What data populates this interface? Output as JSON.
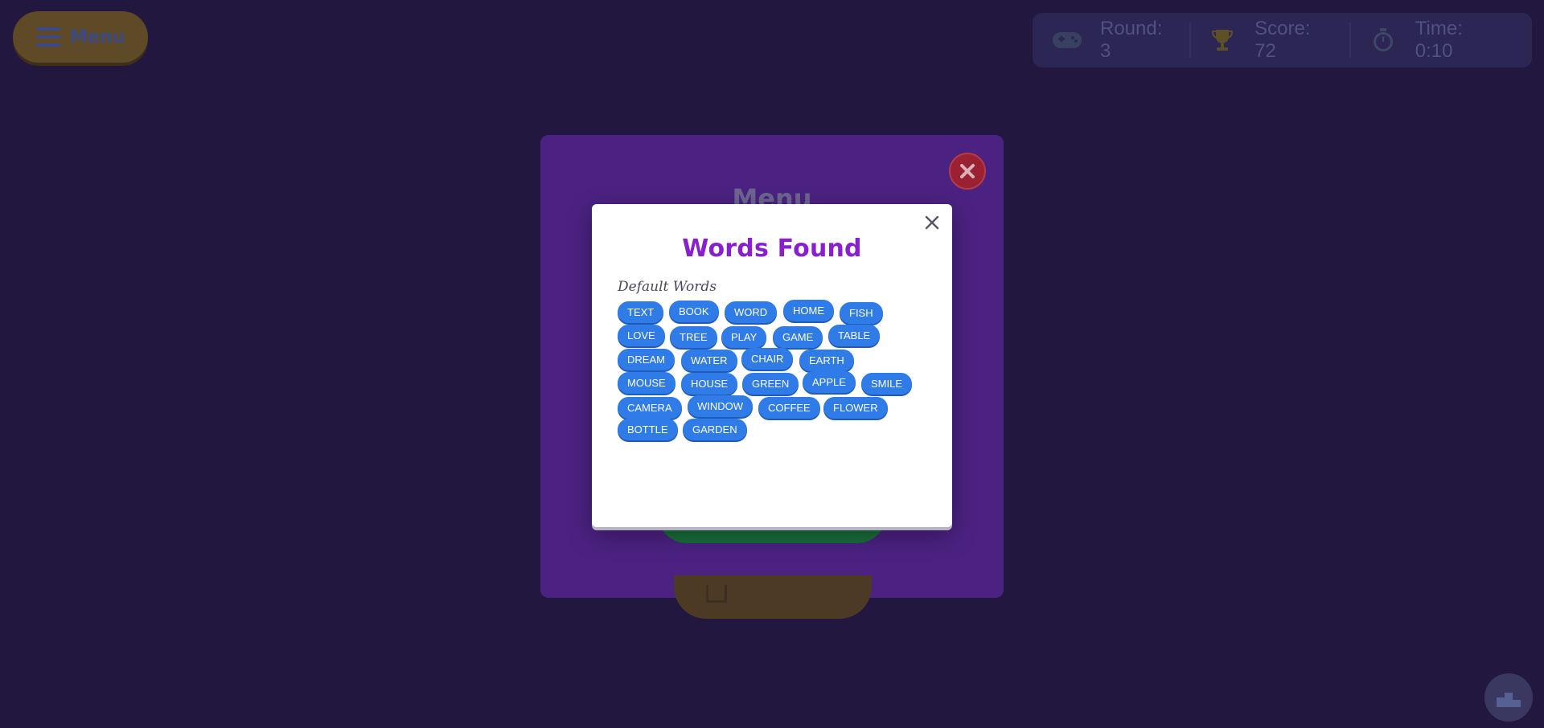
{
  "menu_button": {
    "label": "Menu"
  },
  "stats": {
    "round_label": "Round: 3",
    "score_label": "Score: 72",
    "time_label": "Time: 0:10"
  },
  "menu_panel": {
    "title": "Menu"
  },
  "modal": {
    "title": "Words Found",
    "section_title": "Default Words",
    "words": [
      "TEXT",
      "BOOK",
      "WORD",
      "HOME",
      "FISH",
      "LOVE",
      "TREE",
      "PLAY",
      "GAME",
      "TABLE",
      "DREAM",
      "WATER",
      "CHAIR",
      "EARTH",
      "MOUSE",
      "HOUSE",
      "GREEN",
      "APPLE",
      "SMILE",
      "CAMERA",
      "WINDOW",
      "COFFEE",
      "FLOWER",
      "BOTTLE",
      "GARDEN"
    ]
  },
  "colors": {
    "background": "#22183f",
    "panel": "#4b2282",
    "modal_title": "#8a1fcf",
    "chip": "#2f7be8",
    "close_button": "#9a2132"
  },
  "icons": {
    "menu": "hamburger-icon",
    "round": "gamepad-icon",
    "score": "trophy-icon",
    "time": "stopwatch-icon",
    "panel_close": "close-icon",
    "modal_close": "close-icon",
    "corner": "podium-icon"
  }
}
